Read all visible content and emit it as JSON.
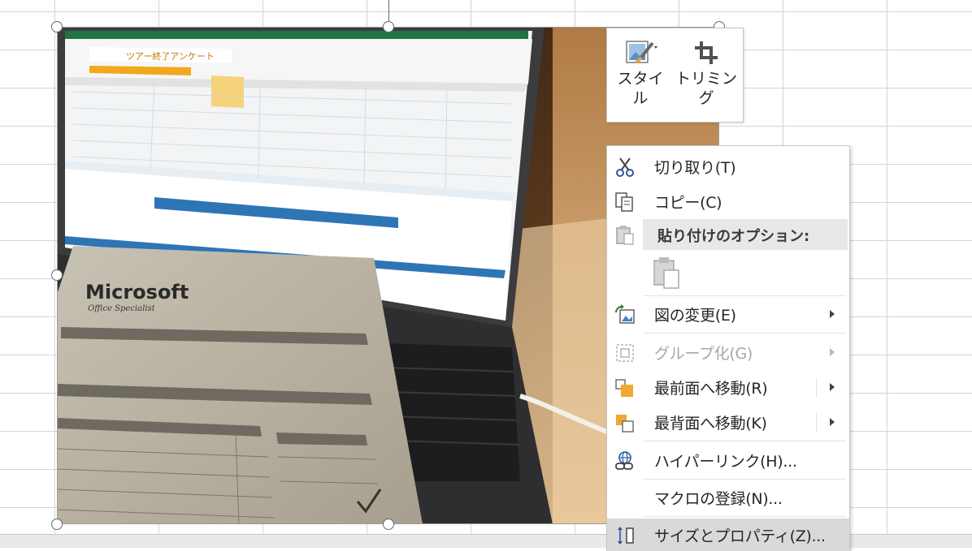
{
  "mini_toolbar": {
    "style_label_line1": "スタイ",
    "style_label_line2": "ル",
    "crop_label": "トリミング"
  },
  "context_menu": {
    "cut": "切り取り(T)",
    "copy": "コピー(C)",
    "paste_options": "貼り付けのオプション:",
    "change_picture": "図の変更(E)",
    "group": "グループ化(G)",
    "bring_to_front": "最前面へ移動(R)",
    "send_to_back": "最背面へ移動(K)",
    "hyperlink": "ハイパーリンク(H)...",
    "assign_macro": "マクロの登録(N)...",
    "size_properties": "サイズとプロパティ(Z)..."
  },
  "photo": {
    "laptop_sheet_title": "ツアー終了アンケート",
    "paper_brand": "Microsoft",
    "paper_subtitle": "Office Specialist"
  },
  "colors": {
    "menu_hover": "#d9d9d9",
    "header_bg": "#e8e8e8",
    "excel_green": "#217346"
  }
}
